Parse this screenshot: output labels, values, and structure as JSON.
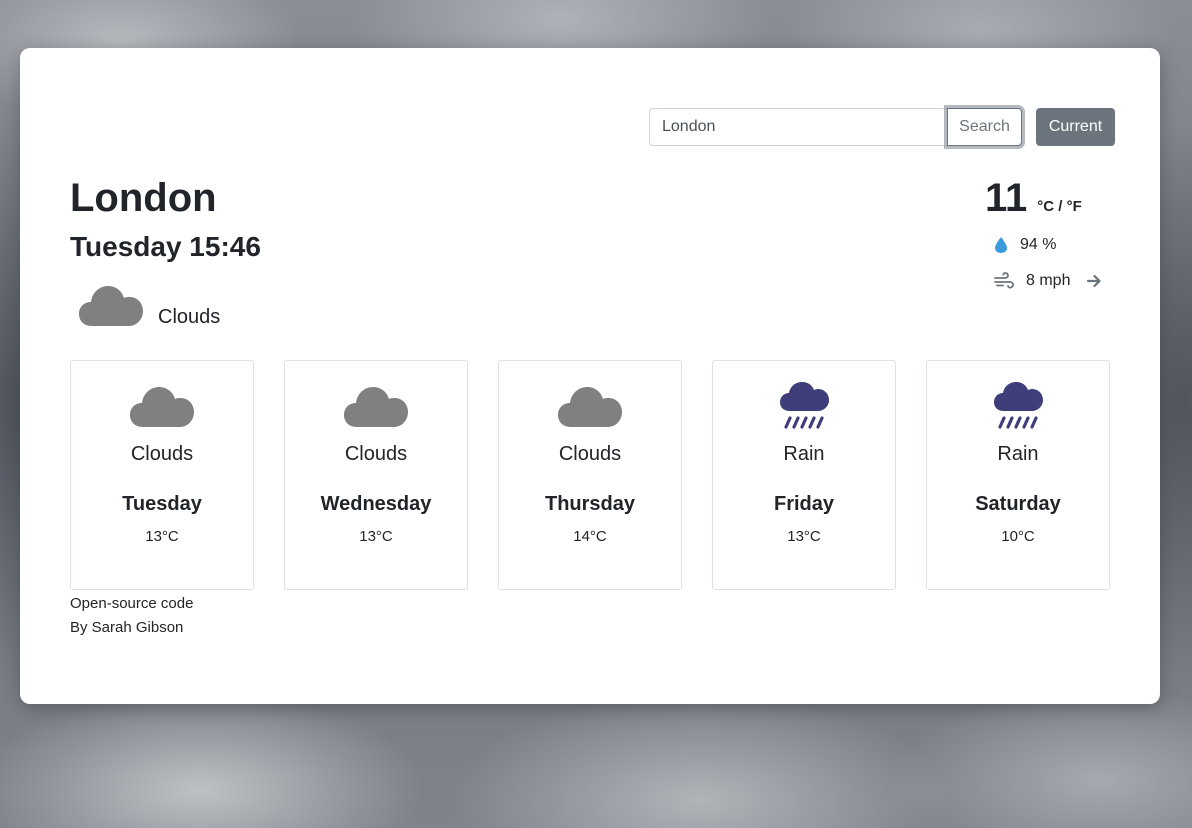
{
  "search": {
    "value": "London",
    "button_label": "Search"
  },
  "current_button_label": "Current",
  "location": {
    "city": "London",
    "datetime": "Tuesday 15:46"
  },
  "current": {
    "icon": "cloud-icon",
    "description": "Clouds",
    "temperature": "11",
    "units": "°C / °F",
    "humidity": "94 %",
    "wind": "8 mph"
  },
  "forecast": [
    {
      "icon": "cloud-icon",
      "description": "Clouds",
      "day": "Tuesday",
      "temp": "13°C"
    },
    {
      "icon": "cloud-icon",
      "description": "Clouds",
      "day": "Wednesday",
      "temp": "13°C"
    },
    {
      "icon": "cloud-icon",
      "description": "Clouds",
      "day": "Thursday",
      "temp": "14°C"
    },
    {
      "icon": "rain-icon",
      "description": "Rain",
      "day": "Friday",
      "temp": "13°C"
    },
    {
      "icon": "rain-icon",
      "description": "Rain",
      "day": "Saturday",
      "temp": "10°C"
    }
  ],
  "footer": {
    "link": "Open-source code",
    "author": "By Sarah Gibson"
  },
  "colors": {
    "cloud": "#808080",
    "rain_cloud": "#3f3d7a",
    "humidity_drop": "#3b9bdc",
    "button_secondary": "#6c757d"
  }
}
